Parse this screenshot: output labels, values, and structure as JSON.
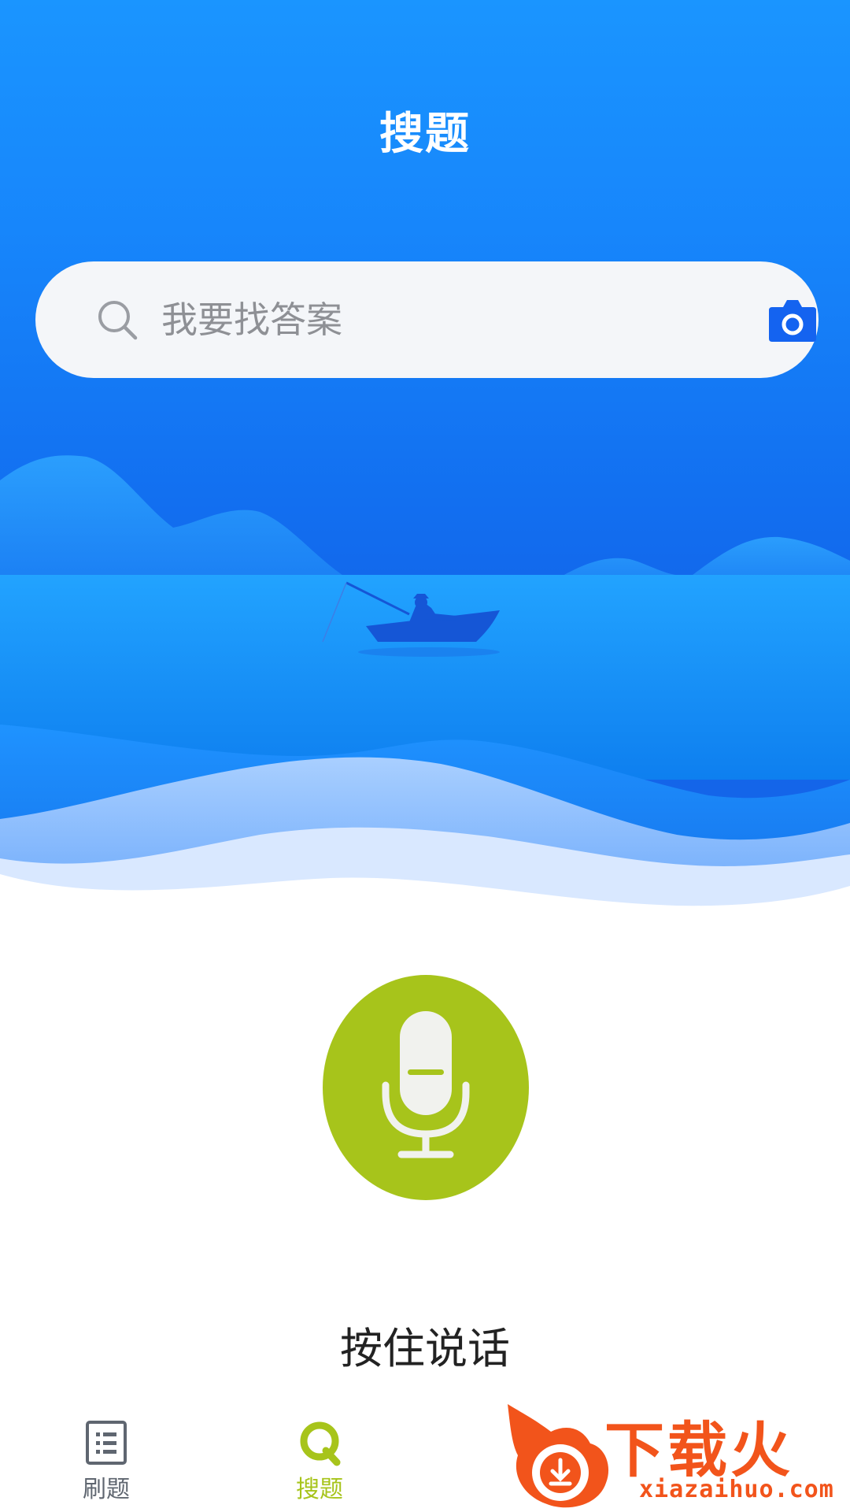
{
  "header": {
    "title": "搜题"
  },
  "search": {
    "placeholder": "我要找答案"
  },
  "voice": {
    "label": "按住说话"
  },
  "tabs": [
    {
      "label": "刷题",
      "icon": "list-icon",
      "active": false
    },
    {
      "label": "搜题",
      "icon": "search-tab-icon",
      "active": true
    }
  ],
  "watermark": {
    "text": "下载火",
    "url": "xiazaihuo.com"
  },
  "colors": {
    "primary_blue": "#1a8cff",
    "accent_green": "#a7c41b",
    "watermark_orange": "#f2541b"
  }
}
